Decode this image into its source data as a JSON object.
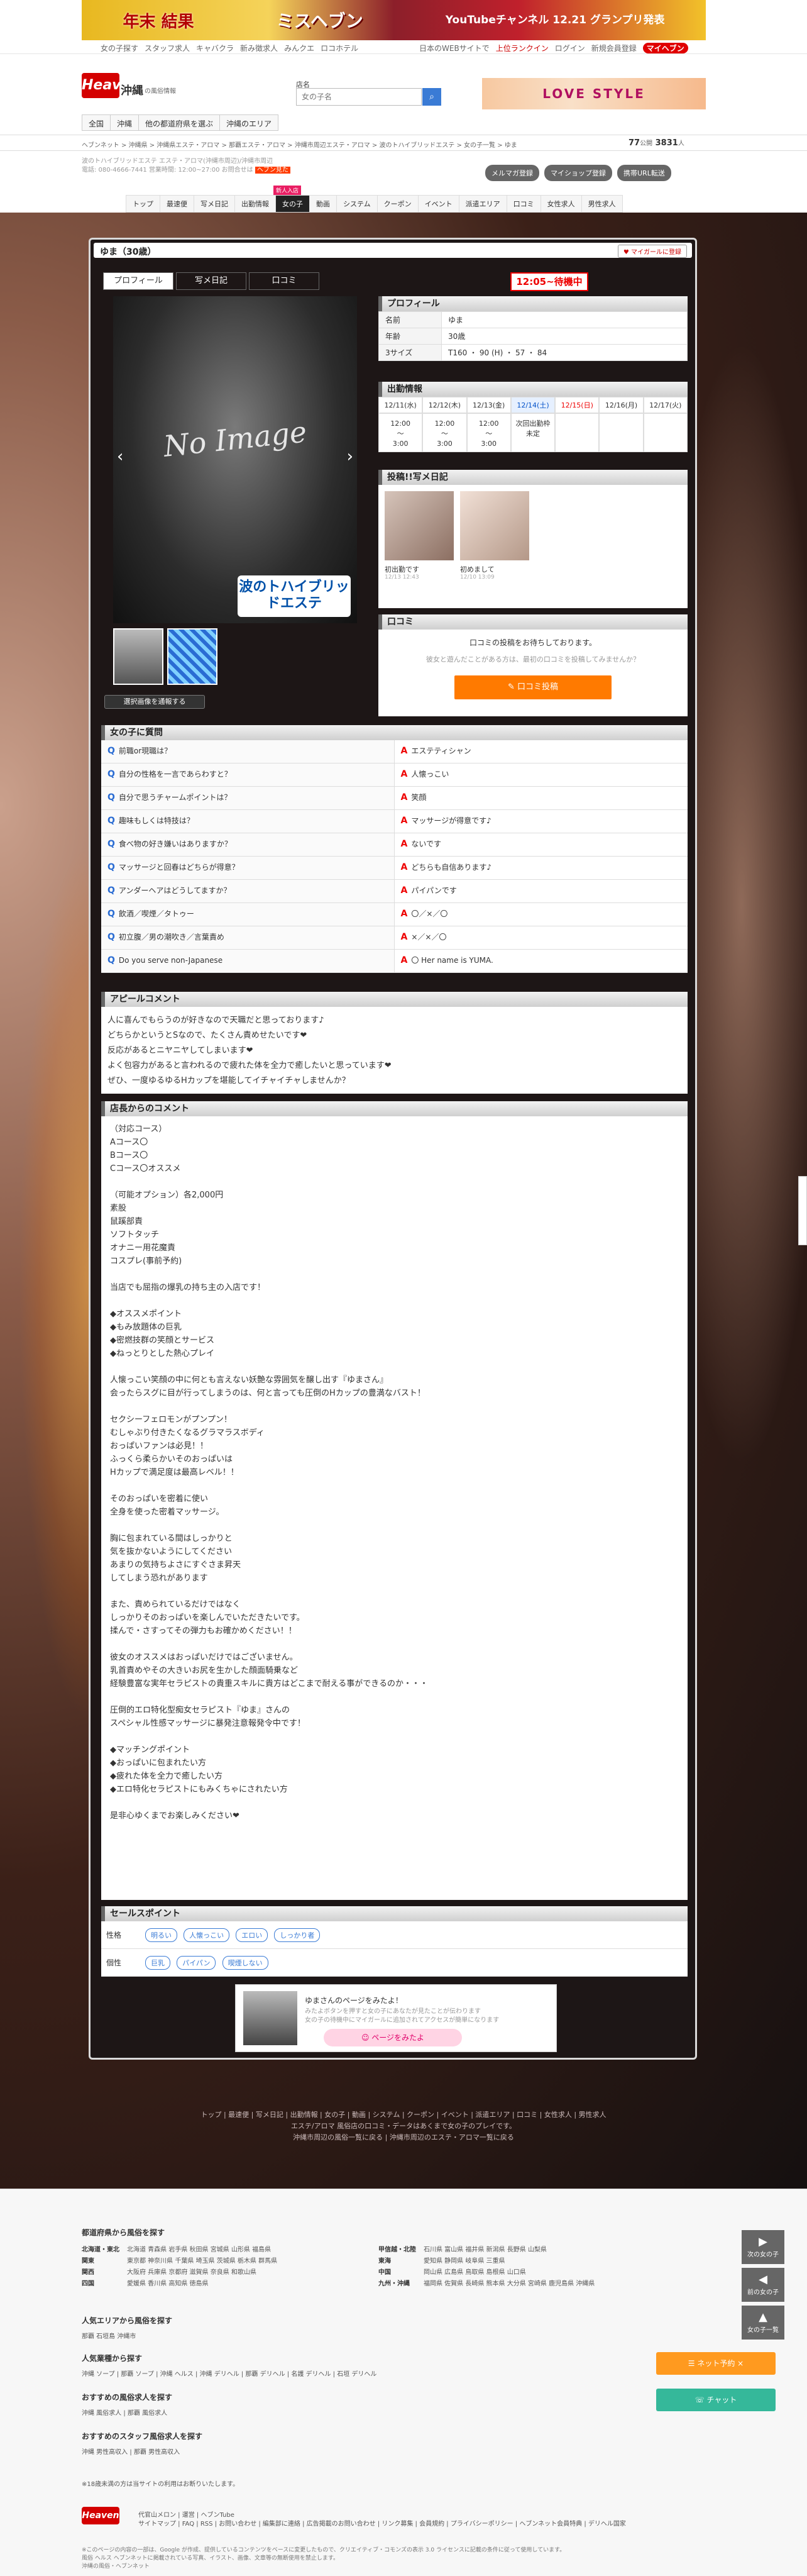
{
  "banner": {
    "a": "年末 結果",
    "b": "ミスヘブン",
    "c": "YouTubeチャンネル\n12.21 グランプリ発表"
  },
  "topnav": {
    "left": [
      "女の子探す",
      "スタッフ求人",
      "キャバクラ",
      "新み徴求人",
      "みんクエ",
      "ロコホテル"
    ],
    "right": [
      "日本のWEBサイトで",
      "上位ランクイン",
      "ログイン",
      "新規会員登録",
      "マイヘブン"
    ]
  },
  "header": {
    "logo": "Heaven",
    "area": "沖縄",
    "area_sub": "の風俗情報",
    "search_label": "店名",
    "search_placeholder": "女の子名",
    "search_icon": "search-icon",
    "side_banner": "LOVE STYLE",
    "area_tabs": [
      "全国",
      "沖縄",
      "他の都道府県を選ぶ",
      "沖縄のエリア"
    ]
  },
  "crumb": {
    "text": "ヘブンネット > 沖縄県 > 沖縄県エステ・アロマ > 那覇エステ・アロマ > 沖縄市周辺エステ・アロマ > 波のトハイブリッドエステ > 女の子一覧 > ゆま",
    "counter_a": "77",
    "counter_a_label": "公開",
    "counter_b": "3831",
    "counter_b_label": "人"
  },
  "shop": {
    "meta1": "波のトハイブリッドエステ エステ・アロマ(沖縄市周辺)/沖縄市周辺",
    "meta2": "電話: 080-4666-7441 営業時間: 12:00~27:00 お問合せは",
    "meta_new": "ヘブン見た",
    "btns": [
      "メルマガ登録",
      "マイショップ登録",
      "携帯URL転送"
    ],
    "tabs": [
      "トップ",
      "最速便",
      "写メ日記",
      "出勤情報",
      "女の子",
      "動画",
      "システム",
      "クーポン",
      "イベント",
      "派遣エリア",
      "口コミ",
      "女性求人",
      "男性求人"
    ],
    "active_tag": "新人入店"
  },
  "girl": {
    "name": "ゆま（30歳）",
    "mypage": "♥ マイガールに登録",
    "tabs": [
      "プロフィール",
      "写メ日記",
      "口コミ"
    ],
    "status": "12:05~待機中",
    "photo_text": "No Image",
    "photo_brand": "波のトハイブリッドエステ",
    "thumb_btn": "選択画像を通報する",
    "profile_title": "プロフィール",
    "profile": [
      {
        "k": "名前",
        "v": "ゆま"
      },
      {
        "k": "年齢",
        "v": "30歳"
      },
      {
        "k": "3サイズ",
        "v": "T160 ・ 90 (H) ・ 57 ・ 84"
      }
    ],
    "sched_title": "出勤情報",
    "sched_days": [
      "12/11(水)",
      "12/12(木)",
      "12/13(金)",
      "12/14(土)",
      "12/15(日)",
      "12/16(月)",
      "12/17(火)"
    ],
    "sched_vals": [
      "12:00\n〜\n3:00",
      "12:00\n〜\n3:00",
      "12:00\n〜\n3:00",
      "次回出勤枠\n未定",
      "",
      "",
      ""
    ],
    "diary_title": "投稿!!写メ日記",
    "diary": [
      {
        "cap": "初出勤です",
        "dt": "12/13 12:43"
      },
      {
        "cap": "初めまして",
        "dt": "12/10 13:09"
      }
    ],
    "review_title": "口コミ",
    "review_msg": "口コミの投稿をお待ちしております。",
    "review_sub": "彼女と遊んだことがある方は、最初の口コミを投稿してみませんか？",
    "review_btn": "✎ 口コミ投稿"
  },
  "qa": {
    "title": "女の子に質問",
    "rows": [
      {
        "q": "前職or現職は？",
        "a": "エステティシャン"
      },
      {
        "q": "自分の性格を一言であらわすと？",
        "a": "人懐っこい"
      },
      {
        "q": "自分で思うチャームポイントは？",
        "a": "笑顔"
      },
      {
        "q": "趣味もしくは特技は？",
        "a": "マッサージが得意です♪"
      },
      {
        "q": "食べ物の好き嫌いはありますか？",
        "a": "ないです"
      },
      {
        "q": "マッサージと回春はどちらが得意？",
        "a": "どちらも自信あります♪"
      },
      {
        "q": "アンダーヘアはどうしてますか？",
        "a": "パイパンです"
      },
      {
        "q": "飲酒／喫煙／タトゥー",
        "a": "〇／×／〇"
      },
      {
        "q": "初立腹／男の潮吹き／言葉責め",
        "a": "×／×／〇"
      },
      {
        "q": "Do you serve non-Japanese",
        "a": "〇 Her name is YUMA."
      }
    ]
  },
  "appeal": {
    "title": "アピールコメント",
    "text": "人に喜んでもらうのが好きなので天職だと思っております♪\nどちらかというとSなので、たくさん責めせたいです❤\n反応があるとニヤニヤしてしまいます❤\nよく包容力があると言われるので疲れた体を全力で癒したいと思っています❤\nぜひ、一度ゆるゆるHカップを堪能してイチャイチャしませんか？"
  },
  "manager": {
    "title": "店長からのコメント",
    "text": "（対応コース）\nAコース〇\nBコース〇\nCコース〇オススメ\n\n（可能オプション）各2,000円\n素股\n鼠蹊部責\nソフトタッチ\nオナニー用花魔責\nコスプレ(事前予約)\n\n当店でも屈指の爆乳の持ち主の入店です！\n\n◆オススメポイント\n◆もみ放題体の巨乳\n◆密燃技群の笑顔とサービス\n◆ねっとりとした熱心プレイ\n\n人懐っこい笑顔の中に何とも言えない妖艶な雰囲気を醸し出す『ゆまさん』\n会ったらスグに目が行ってしまうのは、何と言っても圧倒のHカップの豊満なバスト！\n\nセクシーフェロモンがプンプン！\nむしゃぶり付きたくなるグラマラスボディ\nおっぱいファンは必見！！\nふっくら柔らかいそのおっぱいは\nHカップで満足度は最高レベル！！\n\nそのおっぱいを密着に使い\n全身を使った密着マッサージ。\n\n胸に包まれている間はしっかりと\n気を抜かないようにしてください\nあまりの気持ちよさにすぐさま昇天\nしてしまう恐れがあります\n\nまた、責められているだけではなく\nしっかりそのおっぱいを楽しんでいただきたいです。\n揉んで・さすってその弾力もお確かめください！！\n\n彼女のオススメはおっぱいだけではございません。\n乳首責めやその大きいお尻を生かした顔面騎乗など\n経験豊富な実年セラピストの貴重スキルに貴方はどこまで耐える事ができるのか・・・\n\n圧倒的エロ特化型痴女セラピスト『ゆま』さんの\nスペシャル性感マッサージに暴発注意報発令中です！\n\n◆マッチングポイント\n◆おっぱいに包まれたい方\n◆疲れた体を全力で癒したい方\n◆エロ特化セラピストにもみくちゃにされたい方\n\n是非心ゆくまでお楽しみください❤"
  },
  "sell": {
    "title": "セールスポイント",
    "rows": [
      {
        "k": "性格",
        "tags": [
          "明るい",
          "人懐っこい",
          "エロい",
          "しっかり者"
        ]
      },
      {
        "k": "個性",
        "tags": [
          "巨乳",
          "パイパン",
          "喫煙しない"
        ]
      }
    ]
  },
  "see_me": {
    "t1": "ゆまさんのページをみたよ！",
    "t2": "みたよボタンを押すと女の子にあなたが見たことが伝わります\n女の子の待機中にマイガールに追加されてアクセスが簡単になります",
    "btn": "☺ ページをみたよ"
  },
  "panel_foot": {
    "links": "トップ | 最速便 | 写メ日記 | 出勤情報 | 女の子 | 動画 | システム | クーポン | イベント | 派遣エリア | 口コミ | 女性求人 | 男性求人",
    "line2": "エステ/アロマ 風俗店の口コミ・データはあくまで女の子のプレイです。",
    "line3": "沖縄市周辺の風俗一覧に戻る  |  沖縄市周辺のエステ・アロマ一覧に戻る"
  },
  "footer": {
    "regions_title": "都道府県から風俗を探す",
    "regions": [
      {
        "k": "北海道・東北",
        "v": "北海道  青森県  岩手県  秋田県  宮城県  山形県  福島県",
        "k2": "甲信越・北陸",
        "v2": "石川県  富山県  福井県  新潟県  長野県  山梨県"
      },
      {
        "k": "関東",
        "v": "東京都  神奈川県  千葉県  埼玉県  茨城県  栃木県  群馬県",
        "k2": "東海",
        "v2": "愛知県  静岡県  岐阜県  三重県"
      },
      {
        "k": "関西",
        "v": "大阪府  兵庫県  京都府  滋賀県  奈良県  和歌山県",
        "k2": "中国",
        "v2": "岡山県  広島県  鳥取県  島根県  山口県"
      },
      {
        "k": "四国",
        "v": "愛媛県  香川県  高知県  徳島県",
        "k2": "九州・沖縄",
        "v2": "福岡県  佐賀県  長崎県  熊本県  大分県  宮崎県  鹿児島県  沖縄県"
      }
    ],
    "s1_title": "人気エリアから風俗を探す",
    "s1": "那覇  石垣島  沖縄市",
    "s2_title": "人気業種から探す",
    "s2": "沖縄 ソープ | 那覇 ソープ | 沖縄 ヘルス | 沖縄 デリヘル | 那覇 デリヘル | 名護 デリヘル | 石垣 デリヘル",
    "s3_title": "おすすめの風俗求人を探す",
    "s3": "沖縄 風俗求人 | 那覇 風俗求人",
    "s4_title": "おすすめのスタッフ風俗求人を探す",
    "s4": "沖縄 男性高収入 | 那覇 男性高収入",
    "note": "※18歳未満の方は当サイトの利用はお断りいたします。",
    "logo": "Heaven",
    "links": "代官山メロン | 運営 | ヘブンTube\nサイトマップ | FAQ | RSS | お問い合わせ | 編集部に連絡 | 広告掲載のお問い合わせ | リンク募集 | 会員規約 | プライバシーポリシー | ヘブンネット会員特典 | デリヘル国家",
    "copy": "※このページの内容の一部は、Google が作成、提供しているコンテンツをベースに変更したもので、クリエイティブ・コモンズの表示 3.0 ライセンスに記載の条件に従って使用しています。\n風俗 ヘルス ヘブンネットに掲載されている写真、イラスト、画像、文章等の無断使用を禁止します。\n沖縄の風俗・ヘブンネット"
  },
  "fab": [
    {
      "icon": "▶",
      "label": "次の女の子"
    },
    {
      "icon": "◀",
      "label": "前の女の子"
    },
    {
      "icon": "▲",
      "label": "女の子一覧"
    }
  ],
  "sticky": {
    "b1": "☰ ネット予約 ×",
    "b2": "☏ チャット"
  }
}
